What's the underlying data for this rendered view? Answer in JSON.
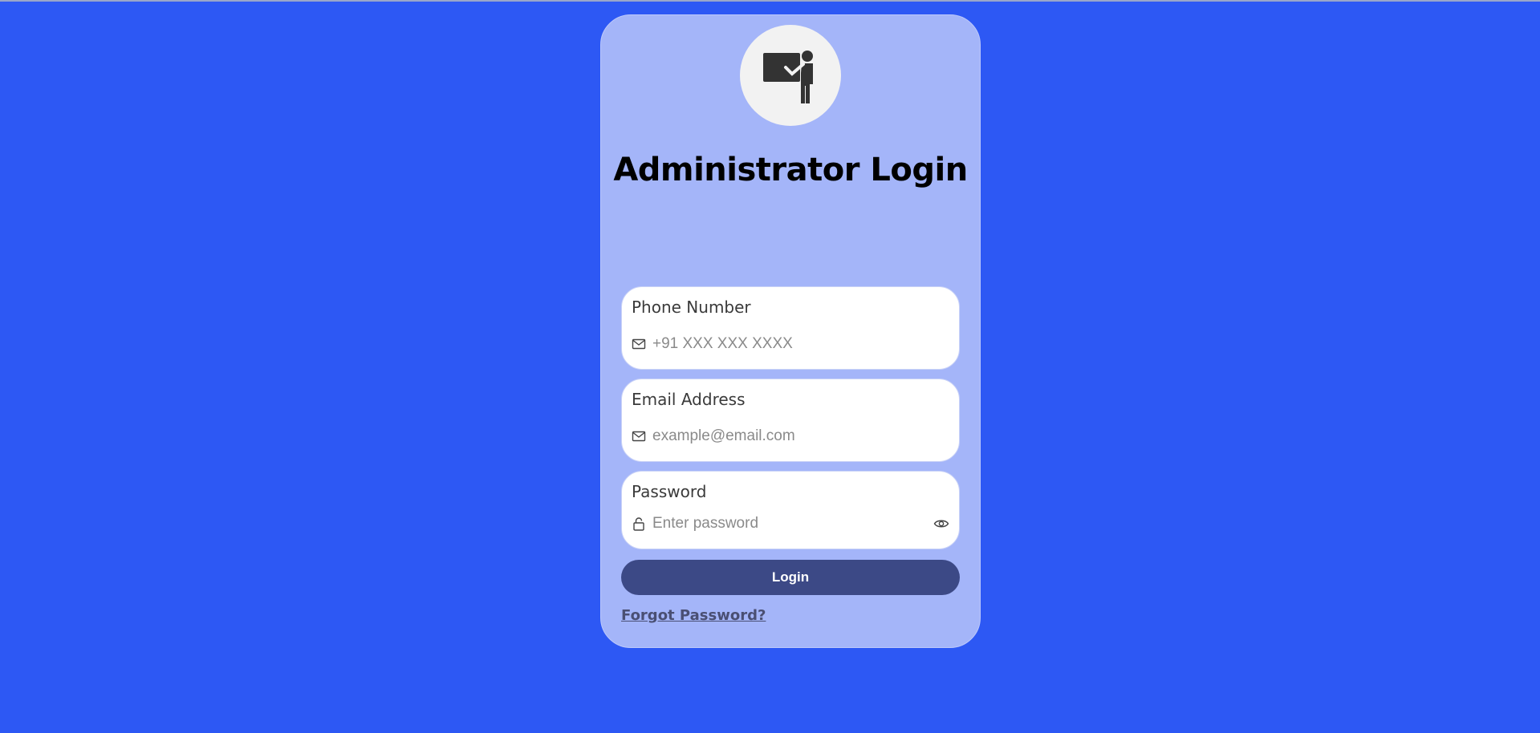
{
  "colors": {
    "background": "#2d58f4",
    "card": "#a4b5f9",
    "button": "#3c4986",
    "link": "#4a4f73"
  },
  "header": {
    "avatar_icon": "teacher-presentation-icon",
    "title": "Administrator Login"
  },
  "form": {
    "phone": {
      "label": "Phone Number",
      "placeholder": "+91 XXX XXX XXXX",
      "value": "",
      "icon": "mail-icon"
    },
    "email": {
      "label": "Email Address",
      "placeholder": "example@email.com",
      "value": "",
      "icon": "mail-icon"
    },
    "password": {
      "label": "Password",
      "placeholder": "Enter password",
      "value": "",
      "icon": "lock-icon",
      "toggle_icon": "eye-icon"
    },
    "login_label": "Login",
    "forgot_label": "Forgot Password?"
  }
}
